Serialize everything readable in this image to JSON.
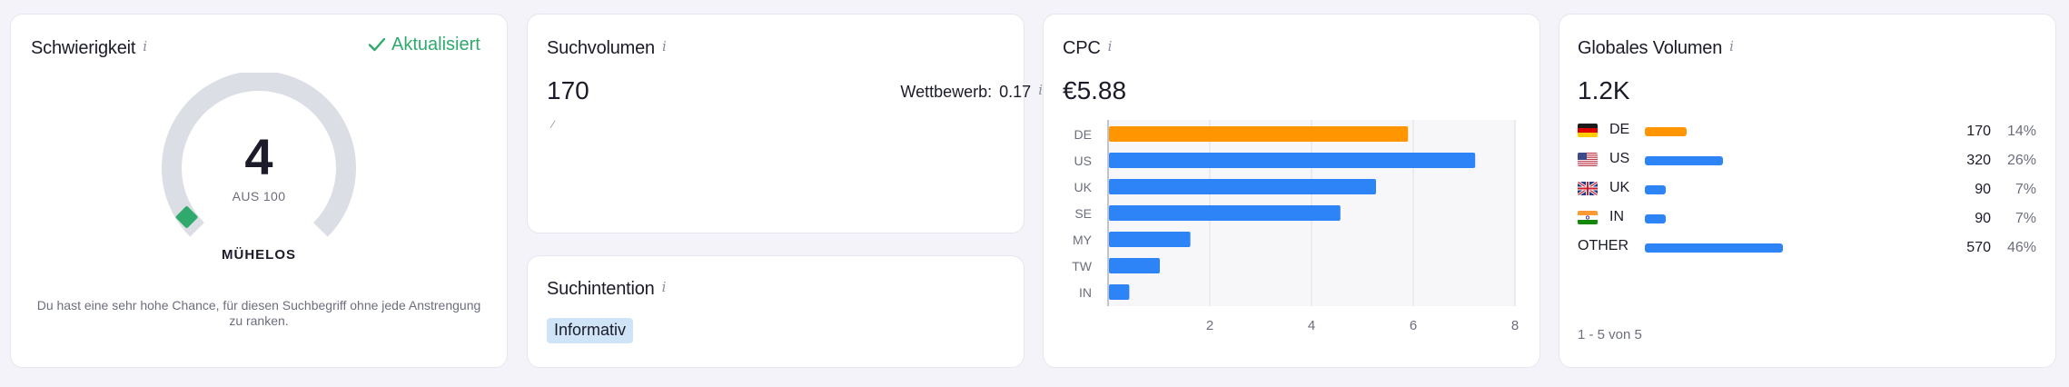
{
  "difficulty": {
    "title": "Schwierigkeit",
    "status": "Aktualisiert",
    "score": "4",
    "score_sub": "AUS 100",
    "level": "MÜHELOS",
    "description": "Du hast eine sehr hohe Chance, für diesen Suchbegriff ohne jede Anstrengung zu ranken.",
    "score_fraction": 0.04,
    "marker_color": "#2faa6c"
  },
  "search_volume": {
    "title": "Suchvolumen",
    "value": "170",
    "trend_mark": "⁄"
  },
  "intent": {
    "title": "Suchintention",
    "badge": "Informativ",
    "badge_color": "#cfe4f7"
  },
  "cpc": {
    "title": "CPC",
    "value": "€5.88",
    "competition_label": "Wettbewerb:",
    "competition_value": "0.17"
  },
  "chart_data": {
    "type": "bar",
    "orientation": "horizontal",
    "categories": [
      "DE",
      "US",
      "UK",
      "SE",
      "MY",
      "TW",
      "IN"
    ],
    "values": [
      5.88,
      7.2,
      5.25,
      4.55,
      1.6,
      1.0,
      0.4
    ],
    "xlim": [
      0,
      8
    ],
    "x_ticks": [
      "2",
      "4",
      "6",
      "8"
    ],
    "grid": true,
    "bar_colors": [
      "#ff9500",
      "#2d84f7",
      "#2d84f7",
      "#2d84f7",
      "#2d84f7",
      "#2d84f7",
      "#2d84f7"
    ]
  },
  "global_volume": {
    "title": "Globales Volumen",
    "value": "1.2K",
    "rows": [
      {
        "code": "DE",
        "flag": "de-flag-icon",
        "volume": "170",
        "percent": "14%",
        "share": 0.14,
        "color": "#ff9500"
      },
      {
        "code": "US",
        "flag": "us-flag-icon",
        "volume": "320",
        "percent": "26%",
        "share": 0.26,
        "color": "#2d84f7"
      },
      {
        "code": "UK",
        "flag": "uk-flag-icon",
        "volume": "90",
        "percent": "7%",
        "share": 0.07,
        "color": "#2d84f7"
      },
      {
        "code": "IN",
        "flag": "in-flag-icon",
        "volume": "90",
        "percent": "7%",
        "share": 0.07,
        "color": "#2d84f7"
      },
      {
        "code": "OTHER",
        "flag": "",
        "volume": "570",
        "percent": "46%",
        "share": 0.46,
        "color": "#2d84f7"
      }
    ],
    "pagination": "1 - 5 von 5"
  }
}
